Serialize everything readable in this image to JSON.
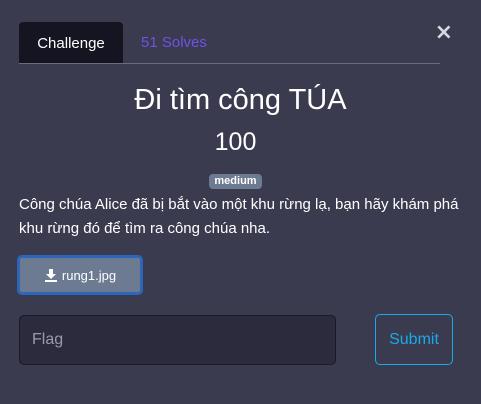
{
  "tabs": {
    "challenge_label": "Challenge",
    "solves_label": "51 Solves"
  },
  "close_label": "×",
  "challenge": {
    "title": "Đi tìm công TÚA",
    "points": "100",
    "difficulty": "medium",
    "description": "Công chúa Alice đã bị bắt vào một khu rừng lạ, bạn hãy khám phá khu rừng đó để tìm ra công chúa nha.",
    "file_name": "rung1.jpg"
  },
  "form": {
    "flag_placeholder": "Flag",
    "flag_value": "",
    "submit_label": "Submit"
  },
  "colors": {
    "background": "#3b3b4f",
    "active_tab": "#151521",
    "solves_link": "#6b54e4",
    "badge": "#6c7a92",
    "submit_accent": "#1aa9ea",
    "file_button_border": "#2f65b8"
  },
  "icons": {
    "close": "close-icon",
    "download": "download-icon"
  }
}
